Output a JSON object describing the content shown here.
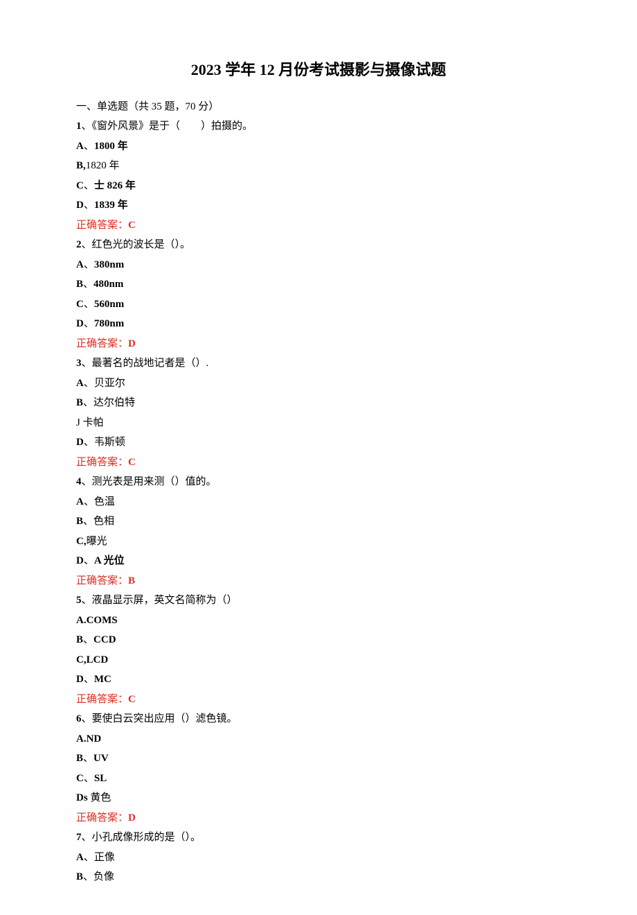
{
  "title": "2023 学年 12 月份考试摄影与摄像试题",
  "section_header": "一、单选题（共 35 题，70 分）",
  "questions": [
    {
      "stem_prefix": "1",
      "stem": "、《窗外风景》是于（　　）拍摄的。",
      "options": [
        {
          "label": "A",
          "sep": "、",
          "text": "1800 年",
          "bold_label": true,
          "bold_text": true
        },
        {
          "label": "B,",
          "sep": "",
          "text": "1820 年",
          "bold_label": true,
          "bold_text": false
        },
        {
          "label": "C",
          "sep": "、",
          "text": "士 826 年",
          "bold_label": true,
          "bold_text": true
        },
        {
          "label": "D",
          "sep": "、",
          "text": "1839 年",
          "bold_label": true,
          "bold_text": true
        }
      ],
      "answer_label": "正确答案：",
      "answer": "C"
    },
    {
      "stem_prefix": "2",
      "stem": "、红色光的波长是（）。",
      "options": [
        {
          "label": "A",
          "sep": "、",
          "text": "380nm",
          "bold_label": true,
          "bold_text": true
        },
        {
          "label": "B",
          "sep": "、",
          "text": "480nm",
          "bold_label": true,
          "bold_text": true
        },
        {
          "label": "C",
          "sep": "、",
          "text": "560nm",
          "bold_label": true,
          "bold_text": true
        },
        {
          "label": "D",
          "sep": "、",
          "text": "780nm",
          "bold_label": true,
          "bold_text": true
        }
      ],
      "answer_label": "正确答案：",
      "answer": "D"
    },
    {
      "stem_prefix": "3",
      "stem": "、最著名的战地记者是（）.",
      "options": [
        {
          "label": "A",
          "sep": "、",
          "text": "贝亚尔",
          "bold_label": true,
          "bold_text": false
        },
        {
          "label": "B",
          "sep": "、",
          "text": "达尔伯特",
          "bold_label": true,
          "bold_text": false
        },
        {
          "label": "J ",
          "sep": "",
          "text": "卡帕",
          "bold_label": false,
          "bold_text": false
        },
        {
          "label": "D",
          "sep": "、",
          "text": "韦斯顿",
          "bold_label": true,
          "bold_text": false
        }
      ],
      "answer_label": "正确答案：",
      "answer": "C"
    },
    {
      "stem_prefix": "4",
      "stem": "、测光表是用来测（）值的。",
      "options": [
        {
          "label": "A",
          "sep": "、",
          "text": "色温",
          "bold_label": true,
          "bold_text": false
        },
        {
          "label": "B",
          "sep": "、",
          "text": "色相",
          "bold_label": true,
          "bold_text": false
        },
        {
          "label": "C,",
          "sep": "",
          "text": "曝光",
          "bold_label": true,
          "bold_text": false
        },
        {
          "label": "D",
          "sep": "、",
          "text": "A 光位",
          "bold_label": true,
          "bold_text": true
        }
      ],
      "answer_label": "正确答案：",
      "answer": "B"
    },
    {
      "stem_prefix": "5",
      "stem": "、液晶显示屏，英文名简称为（）",
      "options": [
        {
          "label": "A.",
          "sep": "",
          "text": "COMS",
          "bold_label": true,
          "bold_text": true
        },
        {
          "label": "B",
          "sep": "、",
          "text": "CCD",
          "bold_label": true,
          "bold_text": true
        },
        {
          "label": "C,",
          "sep": "",
          "text": "LCD",
          "bold_label": true,
          "bold_text": true
        },
        {
          "label": "D",
          "sep": "、",
          "text": "MC",
          "bold_label": true,
          "bold_text": true
        }
      ],
      "answer_label": "正确答案：",
      "answer": "C"
    },
    {
      "stem_prefix": "6",
      "stem": "、要使白云突出应用（）滤色镜。",
      "options": [
        {
          "label": "A.",
          "sep": "",
          "text": "ND",
          "bold_label": true,
          "bold_text": true
        },
        {
          "label": "B",
          "sep": "、",
          "text": "UV",
          "bold_label": true,
          "bold_text": true
        },
        {
          "label": "C",
          "sep": "、",
          "text": "SL",
          "bold_label": true,
          "bold_text": true
        },
        {
          "label": "Ds ",
          "sep": "",
          "text": "黄色",
          "bold_label": true,
          "bold_text": false
        }
      ],
      "answer_label": "正确答案：",
      "answer": "D"
    },
    {
      "stem_prefix": "7",
      "stem": "、小孔成像形成的是（）。",
      "options": [
        {
          "label": "A",
          "sep": "、",
          "text": "正像",
          "bold_label": true,
          "bold_text": false
        },
        {
          "label": "B",
          "sep": "、",
          "text": "负像",
          "bold_label": true,
          "bold_text": false
        }
      ],
      "answer_label": "",
      "answer": ""
    }
  ]
}
